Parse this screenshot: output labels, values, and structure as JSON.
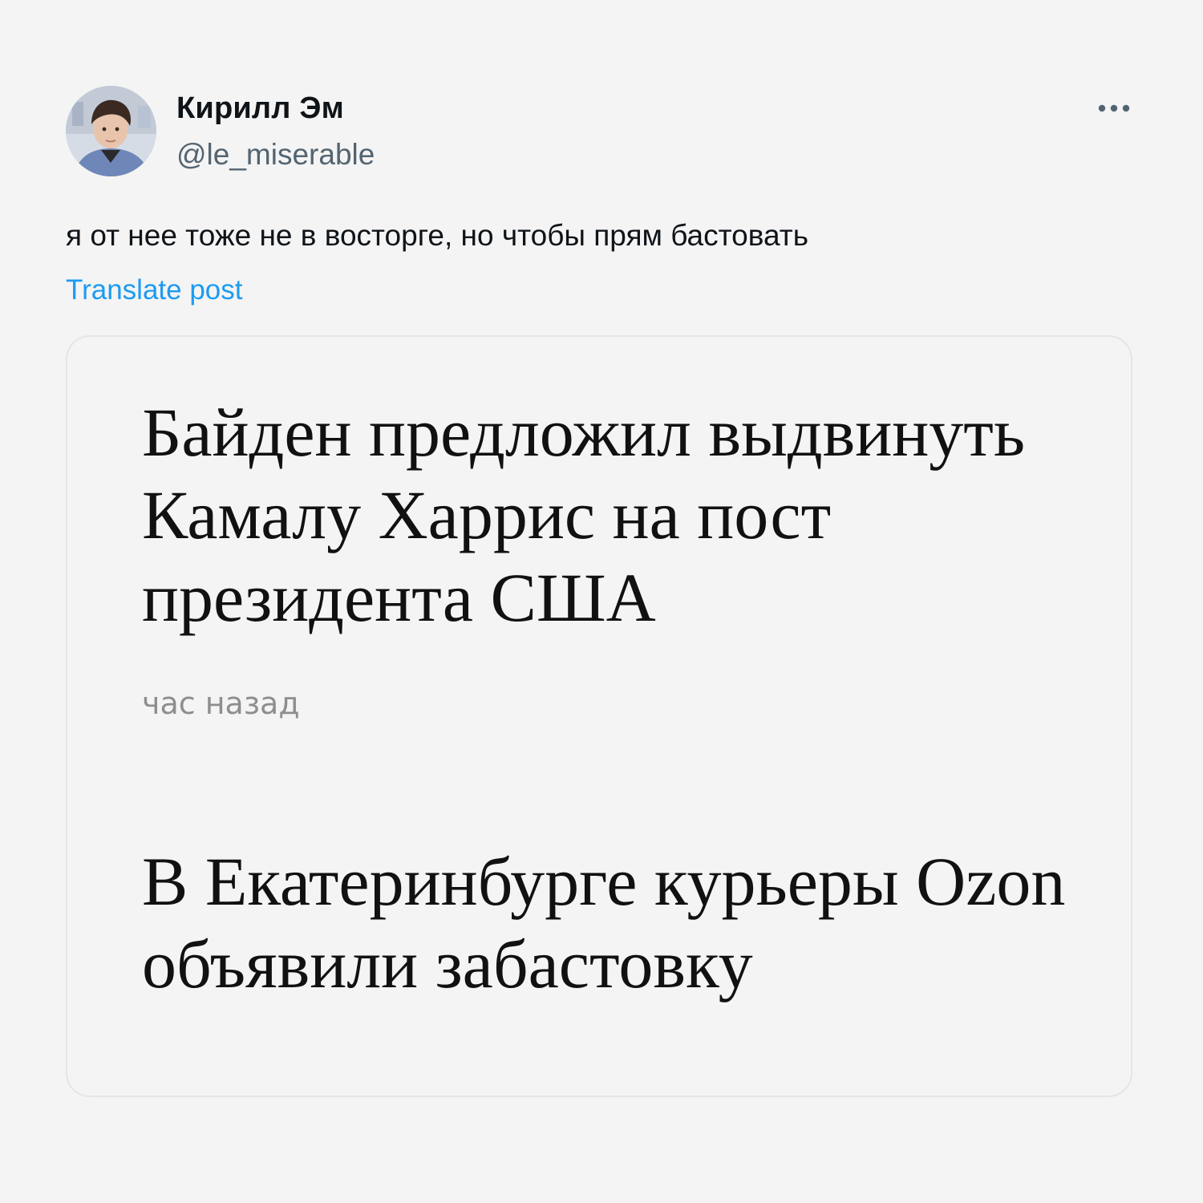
{
  "author": {
    "display_name": "Кирилл Эм",
    "handle": "@le_miserable",
    "avatar_icon": "user-avatar-photo"
  },
  "more_icon": "ellipsis-horizontal-icon",
  "post": {
    "text": "я от нее тоже не в восторге, но чтобы прям бастовать",
    "translate_label": "Translate post"
  },
  "media": {
    "headline_1_lines": [
      "Байден предложил выдвинуть",
      "Камалу Харрис на пост",
      "президента США"
    ],
    "timestamp": "час назад",
    "headline_2_lines": [
      "В Екатеринбурге курьеры Ozon",
      "объявили забастовку"
    ]
  },
  "colors": {
    "background": "#f4f4f4",
    "text_primary": "#0f1419",
    "text_secondary": "#536471",
    "link": "#1d9bf0",
    "card_border": "#e3e6e8",
    "timestamp": "#8e8e8e"
  }
}
